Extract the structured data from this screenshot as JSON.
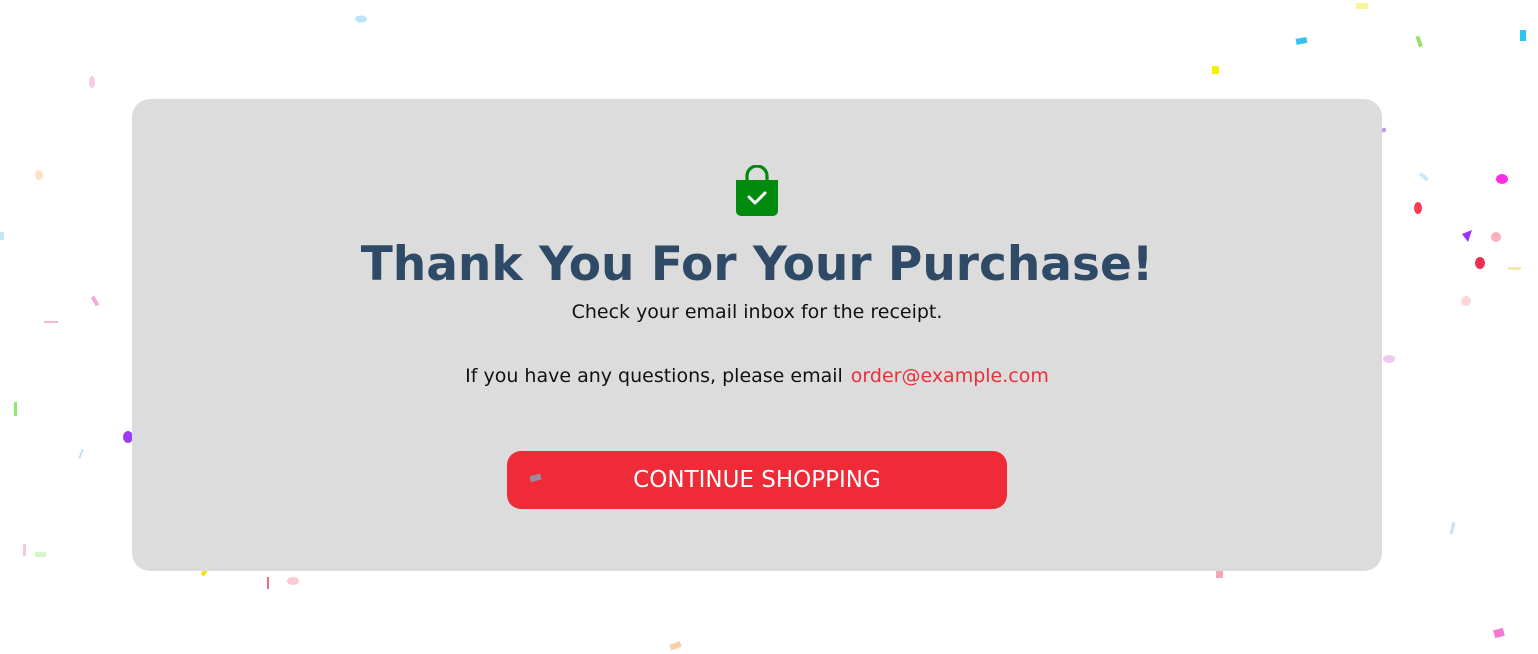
{
  "page": {
    "title": "Thank You For Your Purchase!",
    "receipt_text": "Check your email inbox for the receipt.",
    "questions_text": "If you have any questions, please email",
    "contact_email": "order@example.com",
    "continue_label": "CONTINUE SHOPPING",
    "icon": "shopping-bag-check-icon"
  },
  "colors": {
    "card_background": "#dcdcdc",
    "title": "#2e4a66",
    "accent": "#ef2b37",
    "icon": "#008a0e"
  }
}
